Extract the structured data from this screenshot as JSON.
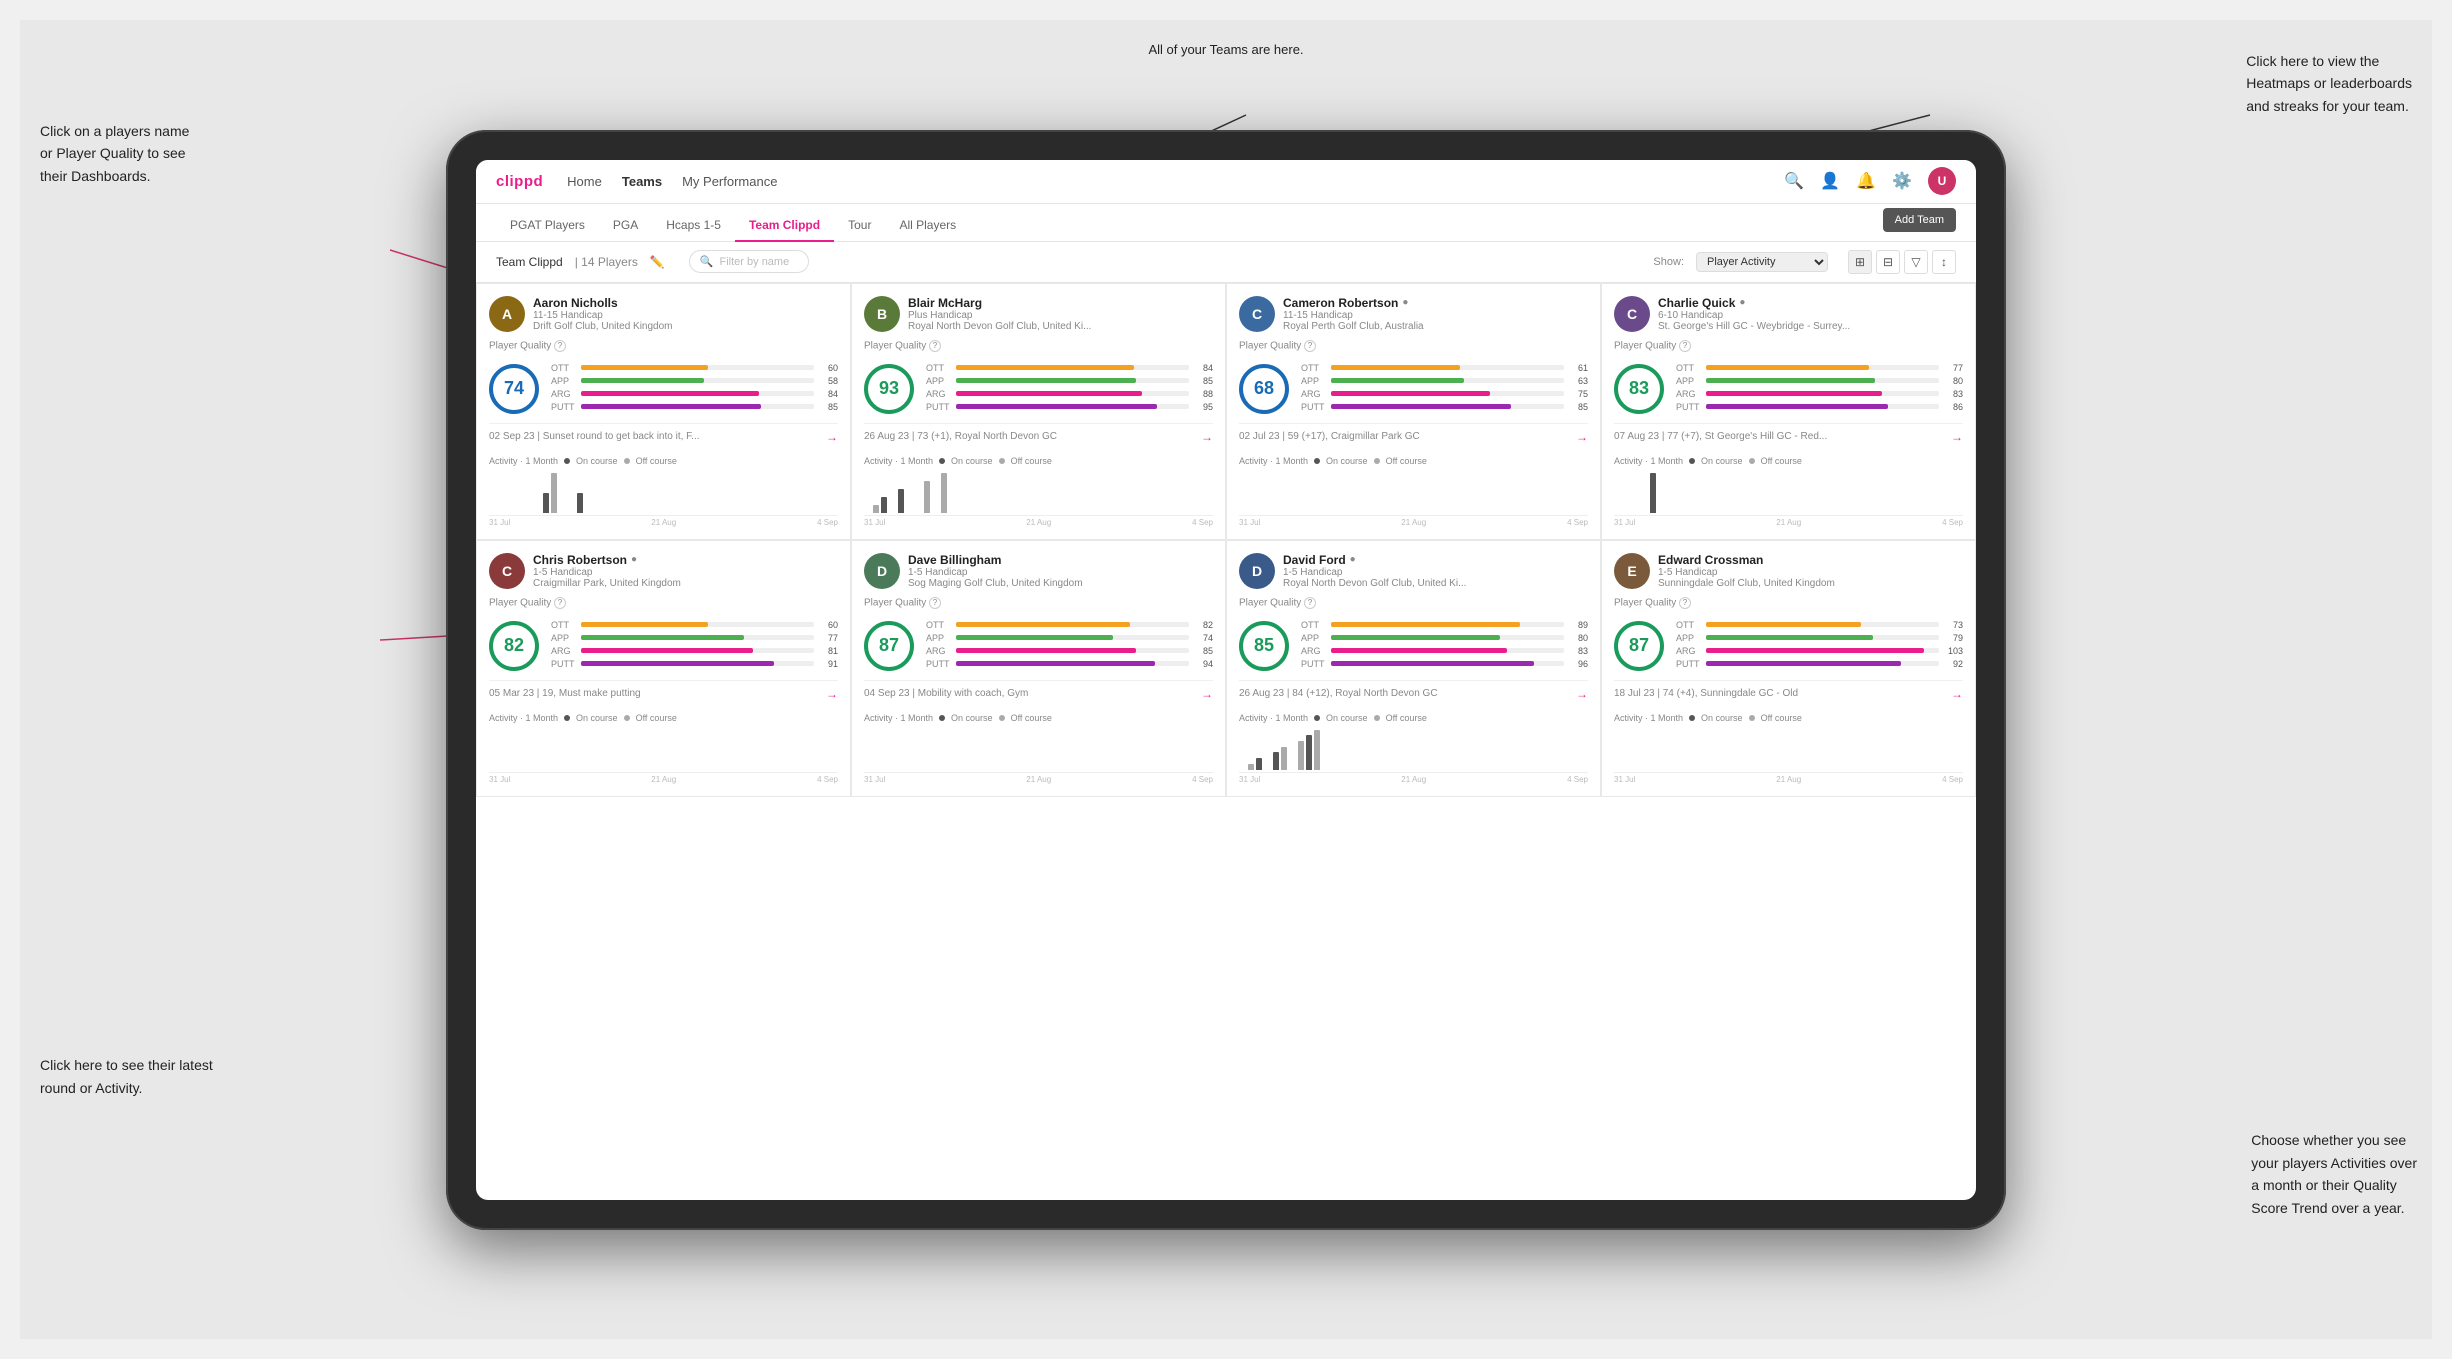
{
  "page": {
    "background": "#e8e8e8"
  },
  "annotations": {
    "top_center": "All of your Teams are here.",
    "top_right_title": "Click here to view the",
    "top_right_lines": [
      "Click here to view the",
      "Heatmaps or leaderboards",
      "and streaks for your team."
    ],
    "left_top_lines": [
      "Click on a players name",
      "or Player Quality to see",
      "their Dashboards."
    ],
    "left_bottom_lines": [
      "Click here to see their latest",
      "round or Activity."
    ],
    "right_bottom_lines": [
      "Choose whether you see",
      "your players Activities over",
      "a month or their Quality",
      "Score Trend over a year."
    ]
  },
  "navbar": {
    "brand": "clippd",
    "links": [
      "Home",
      "Teams",
      "My Performance"
    ],
    "active_link": "Teams"
  },
  "subtabs": {
    "items": [
      "PGAT Players",
      "PGA",
      "Hcaps 1-5",
      "Team Clippd",
      "Tour",
      "All Players"
    ],
    "active": "Team Clippd",
    "add_team_btn": "Add Team"
  },
  "team_header": {
    "name": "Team Clippd",
    "separator": "|",
    "count": "14 Players",
    "search_placeholder": "Filter by name",
    "show_label": "Show:",
    "show_value": "Player Activity",
    "view_buttons": [
      "grid-2",
      "grid-4",
      "filter",
      "sort"
    ]
  },
  "players": [
    {
      "name": "Aaron Nicholls",
      "handicap": "11-15 Handicap",
      "club": "Drift Golf Club, United Kingdom",
      "quality": 74,
      "quality_class": "",
      "ott": 60,
      "app": 58,
      "arg": 84,
      "putt": 85,
      "last_round": "02 Sep 23 | Sunset round to get back into it, F...",
      "chart_data": [
        0,
        0,
        0,
        0,
        0,
        0,
        1,
        2,
        0,
        0,
        1,
        0
      ],
      "chart_dates": [
        "31 Jul",
        "21 Aug",
        "4 Sep"
      ],
      "avatar_color": "#8B6914",
      "avatar_letter": "A"
    },
    {
      "name": "Blair McHarg",
      "handicap": "Plus Handicap",
      "club": "Royal North Devon Golf Club, United Ki...",
      "quality": 93,
      "quality_class": "q93",
      "ott": 84,
      "app": 85,
      "arg": 88,
      "putt": 95,
      "last_round": "26 Aug 23 | 73 (+1), Royal North Devon GC",
      "chart_data": [
        0,
        1,
        2,
        0,
        3,
        0,
        0,
        4,
        0,
        5,
        0,
        0
      ],
      "chart_dates": [
        "31 Jul",
        "21 Aug",
        "4 Sep"
      ],
      "avatar_color": "#5a7a3a",
      "avatar_letter": "B"
    },
    {
      "name": "Cameron Robertson",
      "handicap": "11-15 Handicap",
      "club": "Royal Perth Golf Club, Australia",
      "quality": 68,
      "quality_class": "q68",
      "ott": 61,
      "app": 63,
      "arg": 75,
      "putt": 85,
      "last_round": "02 Jul 23 | 59 (+17), Craigmillar Park GC",
      "chart_data": [
        0,
        0,
        0,
        0,
        0,
        0,
        0,
        0,
        0,
        0,
        0,
        0
      ],
      "chart_dates": [
        "31 Jul",
        "21 Aug",
        "4 Sep"
      ],
      "avatar_color": "#3a6aa0",
      "avatar_letter": "C",
      "verified": true
    },
    {
      "name": "Charlie Quick",
      "handicap": "6-10 Handicap",
      "club": "St. George's Hill GC - Weybridge - Surrey...",
      "quality": 83,
      "quality_class": "q83",
      "ott": 77,
      "app": 80,
      "arg": 83,
      "putt": 86,
      "last_round": "07 Aug 23 | 77 (+7), St George's Hill GC - Red...",
      "chart_data": [
        0,
        0,
        0,
        0,
        1,
        0,
        0,
        0,
        0,
        0,
        0,
        0
      ],
      "chart_dates": [
        "31 Jul",
        "21 Aug",
        "4 Sep"
      ],
      "avatar_color": "#6a4a8a",
      "avatar_letter": "C",
      "verified": true
    },
    {
      "name": "Chris Robertson",
      "handicap": "1-5 Handicap",
      "club": "Craigmillar Park, United Kingdom",
      "quality": 82,
      "quality_class": "q82",
      "ott": 60,
      "app": 77,
      "arg": 81,
      "putt": 91,
      "last_round": "05 Mar 23 | 19, Must make putting",
      "chart_data": [
        0,
        0,
        0,
        0,
        0,
        0,
        0,
        0,
        0,
        0,
        0,
        0
      ],
      "chart_dates": [
        "31 Jul",
        "21 Aug",
        "4 Sep"
      ],
      "avatar_color": "#8a3a3a",
      "avatar_letter": "C",
      "verified": true
    },
    {
      "name": "Dave Billingham",
      "handicap": "1-5 Handicap",
      "club": "Sog Maging Golf Club, United Kingdom",
      "quality": 87,
      "quality_class": "q87",
      "ott": 82,
      "app": 74,
      "arg": 85,
      "putt": 94,
      "last_round": "04 Sep 23 | Mobility with coach, Gym",
      "chart_data": [
        0,
        0,
        0,
        0,
        0,
        0,
        0,
        0,
        0,
        0,
        0,
        0
      ],
      "chart_dates": [
        "31 Jul",
        "21 Aug",
        "4 Sep"
      ],
      "avatar_color": "#4a7a5a",
      "avatar_letter": "D"
    },
    {
      "name": "David Ford",
      "handicap": "1-5 Handicap",
      "club": "Royal North Devon Golf Club, United Ki...",
      "quality": 85,
      "quality_class": "q85",
      "ott": 89,
      "app": 80,
      "arg": 83,
      "putt": 96,
      "last_round": "26 Aug 23 | 84 (+12), Royal North Devon GC",
      "chart_data": [
        0,
        1,
        2,
        0,
        3,
        4,
        0,
        5,
        6,
        7,
        0,
        0
      ],
      "chart_dates": [
        "31 Jul",
        "21 Aug",
        "4 Sep"
      ],
      "avatar_color": "#3a5a8a",
      "avatar_letter": "D",
      "verified": true
    },
    {
      "name": "Edward Crossman",
      "handicap": "1-5 Handicap",
      "club": "Sunningdale Golf Club, United Kingdom",
      "quality": 87,
      "quality_class": "q87b",
      "ott": 73,
      "app": 79,
      "arg": 103,
      "putt": 92,
      "last_round": "18 Jul 23 | 74 (+4), Sunningdale GC - Old",
      "chart_data": [
        0,
        0,
        0,
        0,
        0,
        0,
        0,
        0,
        0,
        0,
        0,
        0
      ],
      "chart_dates": [
        "31 Jul",
        "21 Aug",
        "4 Sep"
      ],
      "avatar_color": "#7a5a3a",
      "avatar_letter": "E"
    }
  ],
  "activity": {
    "title": "Activity",
    "period": "1 Month",
    "on_course": "On course",
    "off_course": "Off course"
  }
}
